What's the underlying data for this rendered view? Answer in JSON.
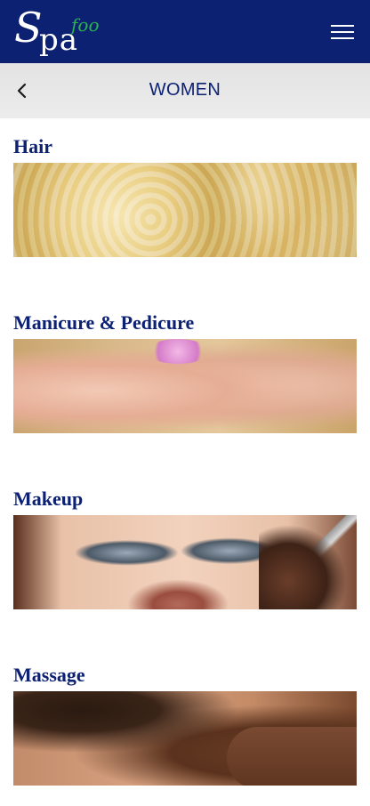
{
  "header": {
    "logo": {
      "main": "S",
      "rest": "pa",
      "accent": "foo"
    },
    "menu_icon": "hamburger-menu-icon",
    "brand_color": "#0d2173",
    "accent_color": "#2bb24c"
  },
  "subheader": {
    "back_icon": "chevron-left-icon",
    "title": "WOMEN"
  },
  "categories": [
    {
      "title": "Hair",
      "image": "hair-image"
    },
    {
      "title": "Manicure & Pedicure",
      "image": "nails-image"
    },
    {
      "title": "Makeup",
      "image": "makeup-image"
    },
    {
      "title": "Massage",
      "image": "massage-image"
    }
  ]
}
